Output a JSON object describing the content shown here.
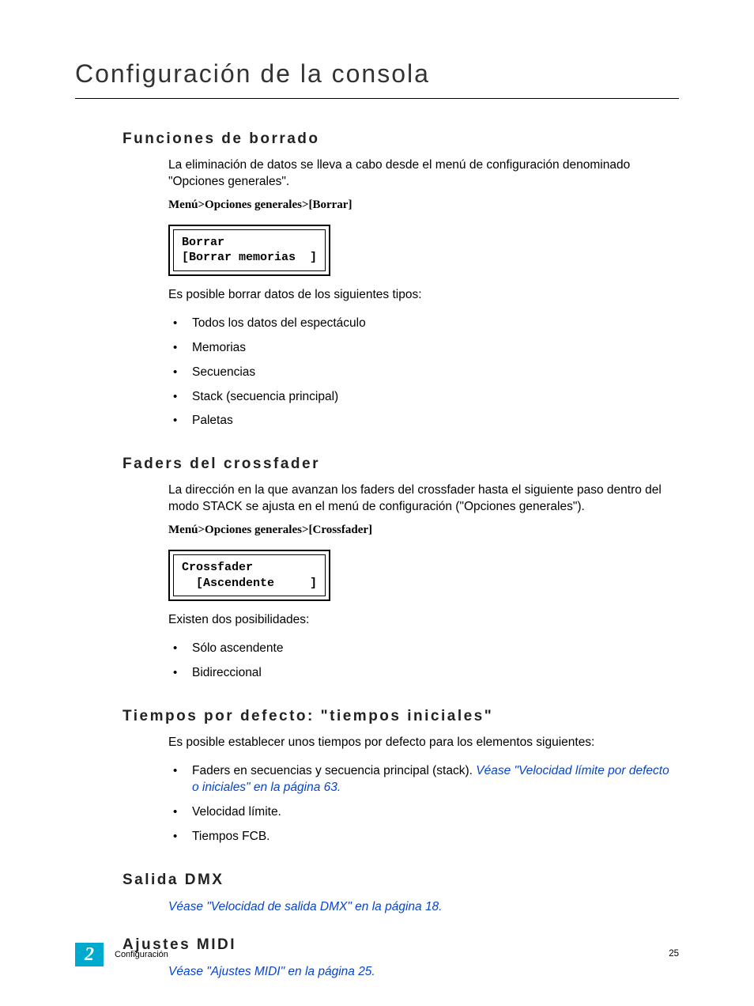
{
  "chapterTitle": "Configuración de la consola",
  "sections": {
    "s1": {
      "heading": "Funciones de borrado",
      "para1": "La eliminación de datos se lleva a cabo desde el menú de configuración denominado \"Opciones generales\".",
      "menuPath": "Menú>Opciones generales>[Borrar]",
      "lcdLine1": "Borrar",
      "lcdLine2": "[Borrar memorias  ]",
      "para2": "Es posible borrar datos de los siguientes tipos:",
      "bullets": {
        "b0": "Todos los datos del espectáculo",
        "b1": "Memorias",
        "b2": "Secuencias",
        "b3": "Stack (secuencia principal)",
        "b4": "Paletas"
      }
    },
    "s2": {
      "heading": "Faders del crossfader",
      "para1": "La dirección en la que avanzan los faders del crossfader hasta el siguiente paso dentro del modo STACK se ajusta en el menú de configuración (\"Opciones generales\").",
      "menuPath": "Menú>Opciones generales>[Crossfader]",
      "lcdLine1": "Crossfader",
      "lcdLine2": "  [Ascendente     ]",
      "para2": "Existen dos posibilidades:",
      "bullets": {
        "b0": "Sólo ascendente",
        "b1": "Bidireccional"
      }
    },
    "s3": {
      "heading": "Tiempos por defecto: \"tiempos iniciales\"",
      "para1": "Es posible establecer unos tiempos por defecto para los elementos siguientes:",
      "bullets": {
        "b0_pre": "Faders en secuencias y secuencia principal (stack). ",
        "b0_link": "Véase \"Velocidad límite por defecto o iniciales\" en la página  63.",
        "b1": "Velocidad límite.",
        "b2": "Tiempos FCB."
      }
    },
    "s4": {
      "heading": "Salida DMX",
      "link": "Véase \"Velocidad de salida DMX\" en la página  18."
    },
    "s5": {
      "heading": "Ajustes MIDI",
      "link": "Véase \"Ajustes MIDI\" en la página  25."
    }
  },
  "footer": {
    "chapterNumber": "2",
    "sectionName": "Configuración",
    "pageNumber": "25"
  }
}
